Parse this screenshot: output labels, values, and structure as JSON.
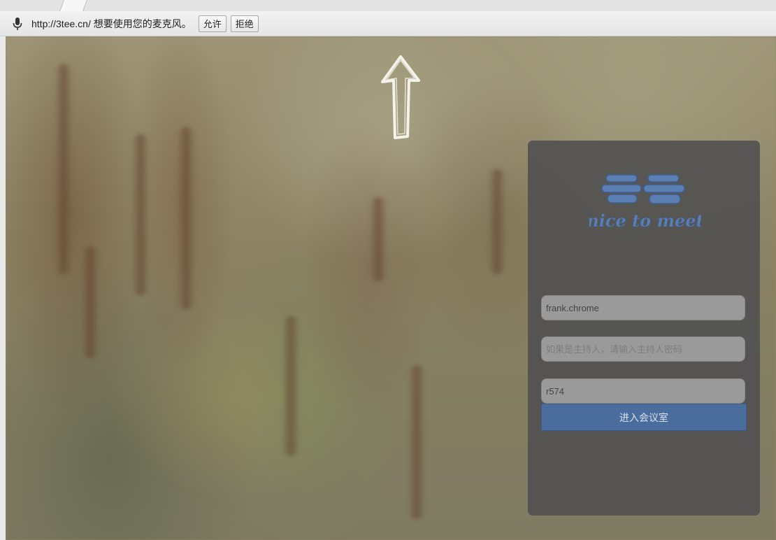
{
  "infobar": {
    "message": "http://3tee.cn/ 想要使用您的麦克风。",
    "allow_label": "允许",
    "deny_label": "拒绝"
  },
  "login": {
    "logo_text": "nice to meet",
    "username_value": "frank.chrome",
    "password_placeholder": "如果是主持人，请输入主持人密码",
    "room_value": "r574",
    "enter_label": "进入会议室"
  },
  "colors": {
    "panel": "#4e4e50",
    "button": "#4a6d9e",
    "logo": "#5b7fb3"
  }
}
